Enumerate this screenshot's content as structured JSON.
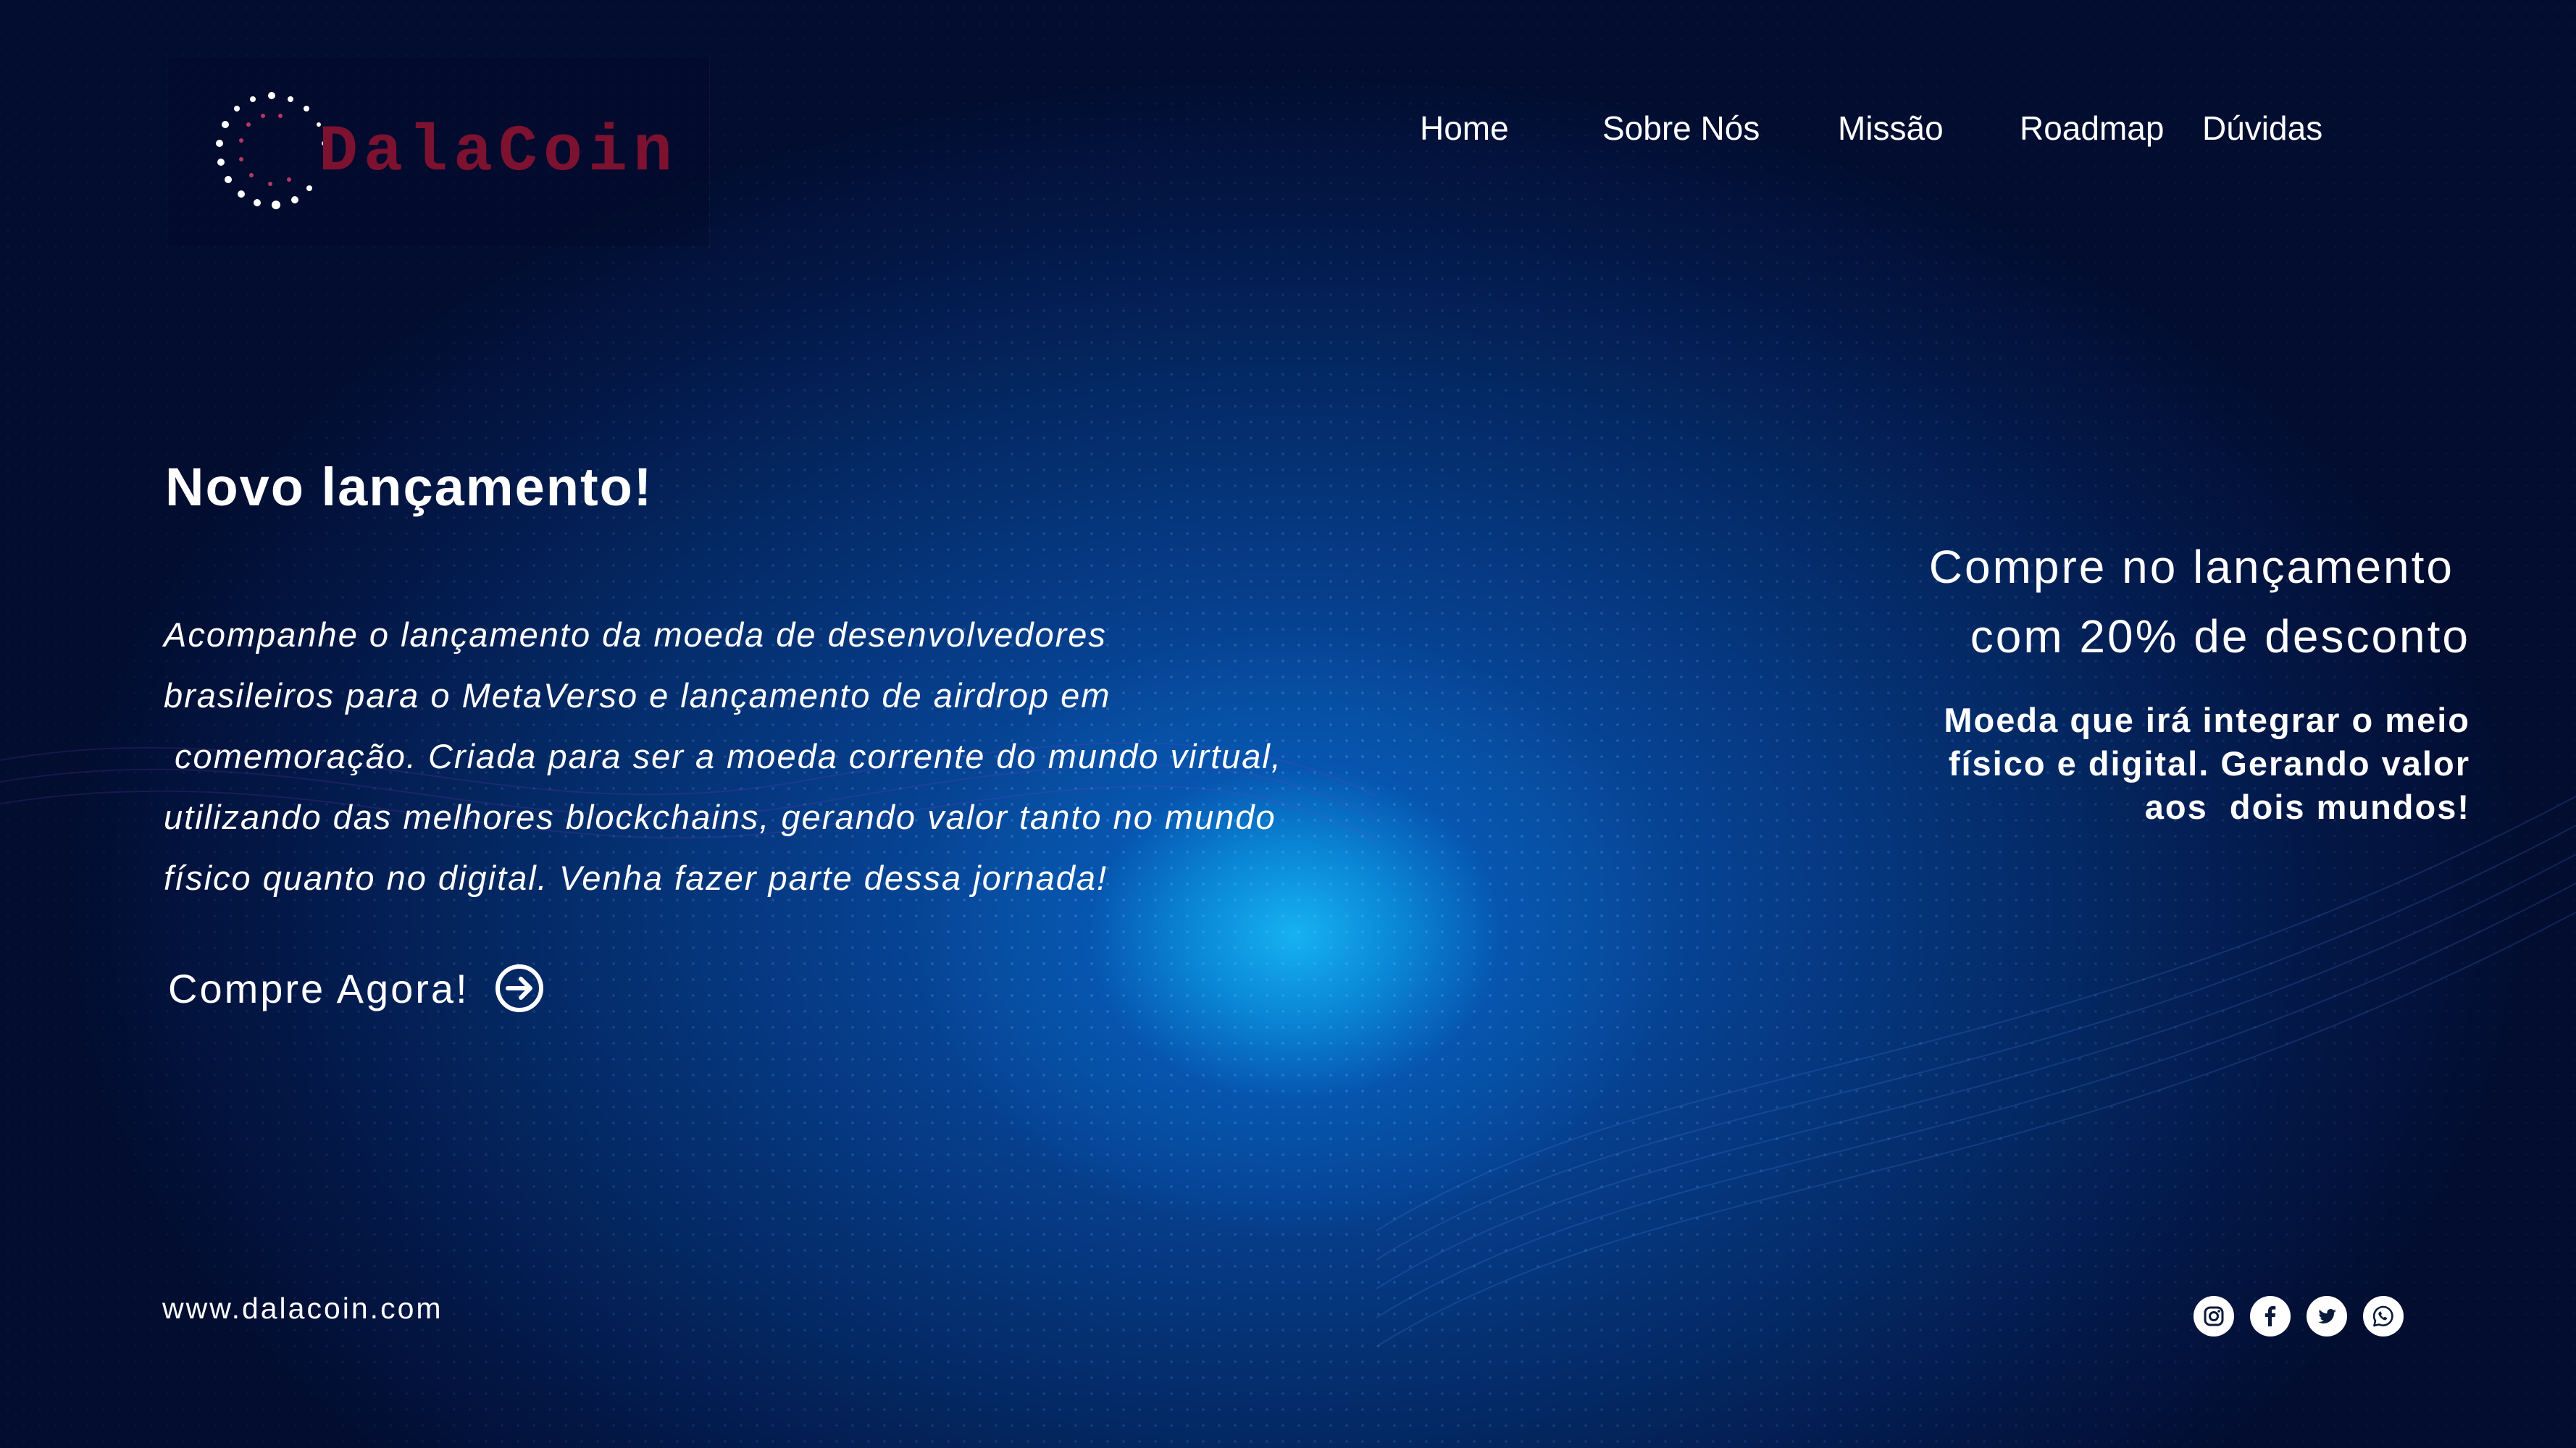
{
  "brand": {
    "name": "DalaCoin",
    "logo_icon": "dotted-ring-logo",
    "color": "#7d1230"
  },
  "nav": {
    "items": [
      {
        "label": "Home"
      },
      {
        "label": "Sobre Nós"
      },
      {
        "label": "Missão"
      },
      {
        "label": "Roadmap"
      },
      {
        "label": "Dúvidas"
      }
    ]
  },
  "hero": {
    "title": "Novo lançamento!",
    "description_lines": [
      "Acompanhe o lançamento da moeda de desenvolvedores",
      "brasileiros para o MetaVerso e lançamento de airdrop em",
      " comemoração. Criada para ser a moeda corrente do mundo virtual,",
      "utilizando das melhores blockchains, gerando valor tanto no mundo",
      "físico quanto no digital. Venha fazer parte dessa jornada!"
    ],
    "cta_label": "Compre Agora!",
    "cta_icon": "arrow-circle-right-icon"
  },
  "promo": {
    "headline_lines": [
      "Compre no lançamento",
      "com 20% de desconto"
    ],
    "sub_lines": [
      "Moeda que irá integrar o meio",
      "físico e digital. Gerando valor",
      "aos  dois mundos!"
    ]
  },
  "footer": {
    "url": "www.dalacoin.com",
    "socials": [
      "instagram-icon",
      "facebook-icon",
      "twitter-icon",
      "whatsapp-icon"
    ]
  },
  "colors": {
    "background_dark": "#020b2a",
    "glow": "#16b2f0",
    "text": "#ffffff"
  }
}
